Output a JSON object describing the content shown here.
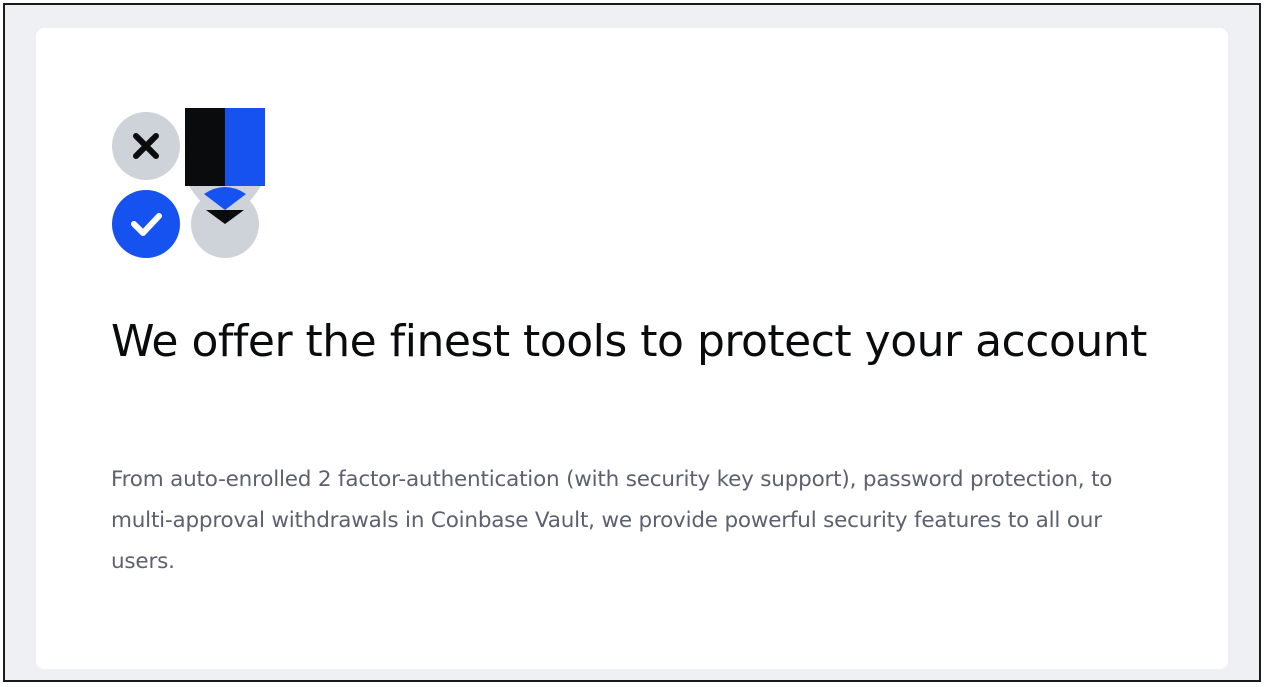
{
  "card": {
    "illustration": {
      "icons": [
        "close-icon",
        "check-icon",
        "chevron-down-icon",
        "key-icon"
      ],
      "colors": {
        "blue": "#1652f0",
        "black": "#0a0b0d",
        "gray": "#ced2d9",
        "white": "#ffffff"
      }
    },
    "headline": "We offer the finest tools to protect your account",
    "description": "From auto-enrolled 2 factor-authentication (with security key support), password protection, to multi-approval withdrawals in Coinbase Vault, we provide powerful security features to all our users."
  },
  "colors": {
    "page_background": "#eef0f3",
    "card_background": "#ffffff",
    "headline_text": "#0a0b0d",
    "body_text": "#5b616e"
  }
}
